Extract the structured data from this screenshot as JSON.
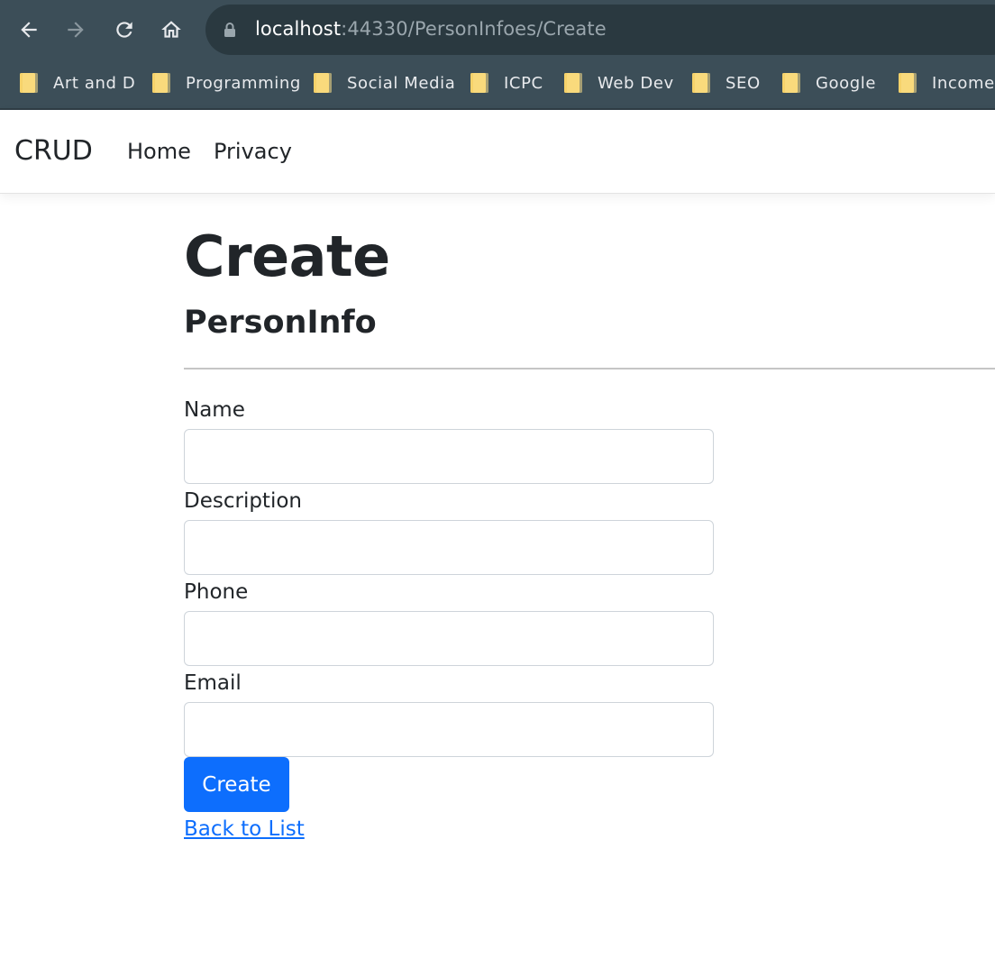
{
  "browser": {
    "url_host": "localhost",
    "url_path": ":44330/PersonInfoes/Create",
    "bookmarks": [
      "Art and D",
      "Programming",
      "Social Media",
      "ICPC",
      "Web Dev",
      "SEO",
      "Google",
      "Income"
    ]
  },
  "navbar": {
    "brand": "CRUD",
    "links": [
      "Home",
      "Privacy"
    ]
  },
  "main": {
    "title": "Create",
    "subtitle": "PersonInfo",
    "fields": [
      {
        "label": "Name",
        "value": ""
      },
      {
        "label": "Description",
        "value": ""
      },
      {
        "label": "Phone",
        "value": ""
      },
      {
        "label": "Email",
        "value": ""
      }
    ],
    "submit_label": "Create",
    "back_link": "Back to List"
  },
  "colors": {
    "chrome_bg": "#3c4e58",
    "omnibox_bg": "#2a3940",
    "primary": "#0d6efd",
    "text": "#212529",
    "folder": "#f6d26a"
  }
}
